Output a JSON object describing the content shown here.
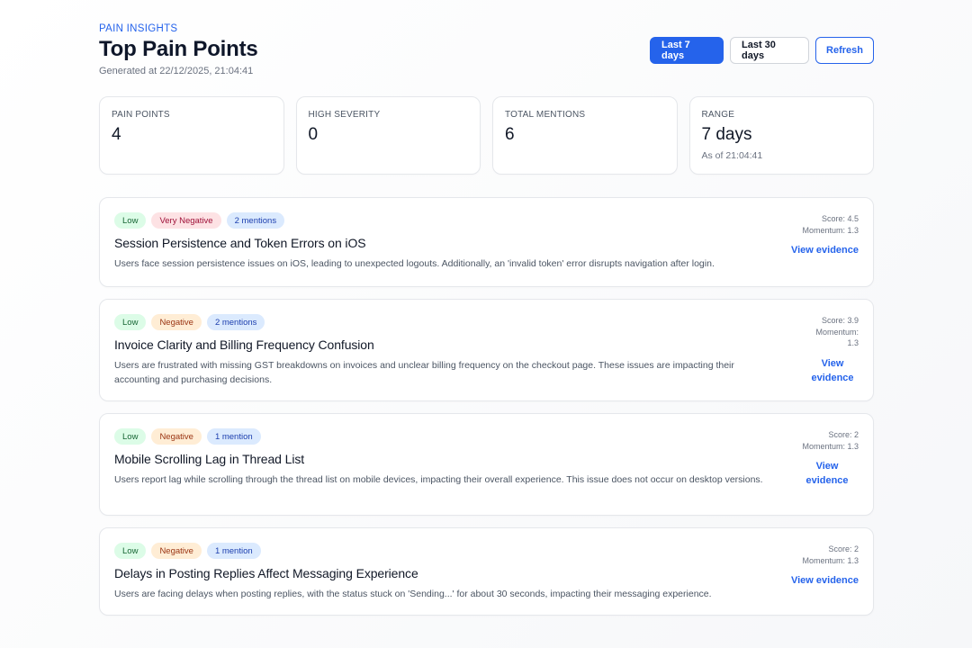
{
  "header": {
    "eyebrow": "PAIN INSIGHTS",
    "title": "Top Pain Points",
    "generated": "Generated at 22/12/2025, 21:04:41"
  },
  "actions": {
    "last7": "Last 7 days",
    "last30": "Last 30 days",
    "refresh": "Refresh"
  },
  "stats": {
    "pain_points": {
      "label": "PAIN POINTS",
      "value": "4"
    },
    "high_severity": {
      "label": "HIGH SEVERITY",
      "value": "0"
    },
    "total_mentions": {
      "label": "TOTAL MENTIONS",
      "value": "6"
    },
    "range": {
      "label": "RANGE",
      "value": "7 days",
      "sub": "As of 21:04:41"
    }
  },
  "cards": [
    {
      "severity": "Low",
      "sentiment": "Very Negative",
      "mentions": "2 mentions",
      "title": "Session Persistence and Token Errors on iOS",
      "description": "Users face session persistence issues on iOS, leading to unexpected logouts. Additionally, an 'invalid token' error disrupts navigation after login.",
      "score": "Score: 4.5",
      "momentum": "Momentum: 1.3",
      "evidence": "View evidence"
    },
    {
      "severity": "Low",
      "sentiment": "Negative",
      "mentions": "2 mentions",
      "title": "Invoice Clarity and Billing Frequency Confusion",
      "description": "Users are frustrated with missing GST breakdowns on invoices and unclear billing frequency on the checkout page. These issues are impacting their accounting and purchasing decisions.",
      "score": "Score: 3.9",
      "momentum": "Momentum: 1.3",
      "evidence": "View evidence"
    },
    {
      "severity": "Low",
      "sentiment": "Negative",
      "mentions": "1 mention",
      "title": "Mobile Scrolling Lag in Thread List",
      "description": "Users report lag while scrolling through the thread list on mobile devices, impacting their overall experience. This issue does not occur on desktop versions.",
      "score": "Score: 2",
      "momentum": "Momentum: 1.3",
      "evidence": "View evidence"
    },
    {
      "severity": "Low",
      "sentiment": "Negative",
      "mentions": "1 mention",
      "title": "Delays in Posting Replies Affect Messaging Experience",
      "description": "Users are facing delays when posting replies, with the status stuck on 'Sending...' for about 30 seconds, impacting their messaging experience.",
      "score": "Score: 2",
      "momentum": "Momentum: 1.3",
      "evidence": "View evidence"
    }
  ]
}
